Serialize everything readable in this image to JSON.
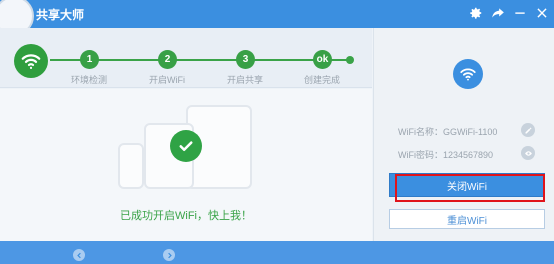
{
  "window": {
    "title": "共享大师",
    "settings_icon": "gear-icon",
    "share_icon": "share-arrow-icon",
    "minimize_icon": "minimize-icon",
    "close_icon": "close-icon"
  },
  "steps": [
    {
      "number": "1",
      "label": "环境检测"
    },
    {
      "number": "2",
      "label": "开启WiFi"
    },
    {
      "number": "3",
      "label": "开启共享"
    },
    {
      "number": "ok",
      "label": "创建完成"
    }
  ],
  "main": {
    "success_message": "已成功开启WiFi，快上我！",
    "status_icon": "check-icon"
  },
  "side": {
    "wifi_icon": "wifi-icon",
    "wifi_name": "WiFi名称：GGWiFi-1100",
    "wifi_password": "WiFi密码：1234567890",
    "edit_icon": "pencil-icon",
    "reveal_icon": "eye-icon",
    "close_button": "关闭WiFi",
    "restart_button": "重启WiFi"
  },
  "colors": {
    "accent": "#3b8fe0",
    "success": "#2fa345",
    "highlight": "#e0141b"
  }
}
